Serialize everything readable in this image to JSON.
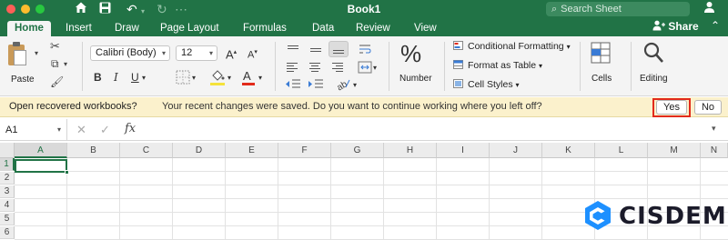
{
  "window": {
    "title": "Book1",
    "search_placeholder": "Search Sheet"
  },
  "ribbon_tabs": [
    "Home",
    "Insert",
    "Draw",
    "Page Layout",
    "Formulas",
    "Data",
    "Review",
    "View"
  ],
  "active_tab": "Home",
  "share_label": "Share",
  "clipboard": {
    "paste_label": "Paste"
  },
  "font": {
    "name": "Calibri (Body)",
    "size": "12"
  },
  "number": {
    "label": "Number",
    "percent_symbol": "%"
  },
  "styles": {
    "conditional_formatting": "Conditional Formatting",
    "format_as_table": "Format as Table",
    "cell_styles": "Cell Styles"
  },
  "cells_label": "Cells",
  "editing_label": "Editing",
  "notification": {
    "title": "Open recovered workbooks?",
    "message": "Your recent changes were saved. Do you want to continue working where you left off?",
    "yes_label": "Yes",
    "no_label": "No"
  },
  "formula_bar": {
    "name_box": "A1",
    "fx_label": "fx"
  },
  "sheet": {
    "columns": [
      "A",
      "B",
      "C",
      "D",
      "E",
      "F",
      "G",
      "H",
      "I",
      "J",
      "K",
      "L",
      "M",
      "N"
    ],
    "rows": [
      "1",
      "2",
      "3",
      "4",
      "5",
      "6"
    ],
    "selected_cell": "A1"
  },
  "watermark": {
    "text": "CISDEM"
  },
  "colors": {
    "excel_green": "#217346",
    "notification_bg": "#fbf1cc",
    "highlight_red": "#e22b1b",
    "font_color_underline": "#e22b1b",
    "fill_color_underline": "#f5e23b",
    "watermark_blue": "#1e90ff"
  }
}
